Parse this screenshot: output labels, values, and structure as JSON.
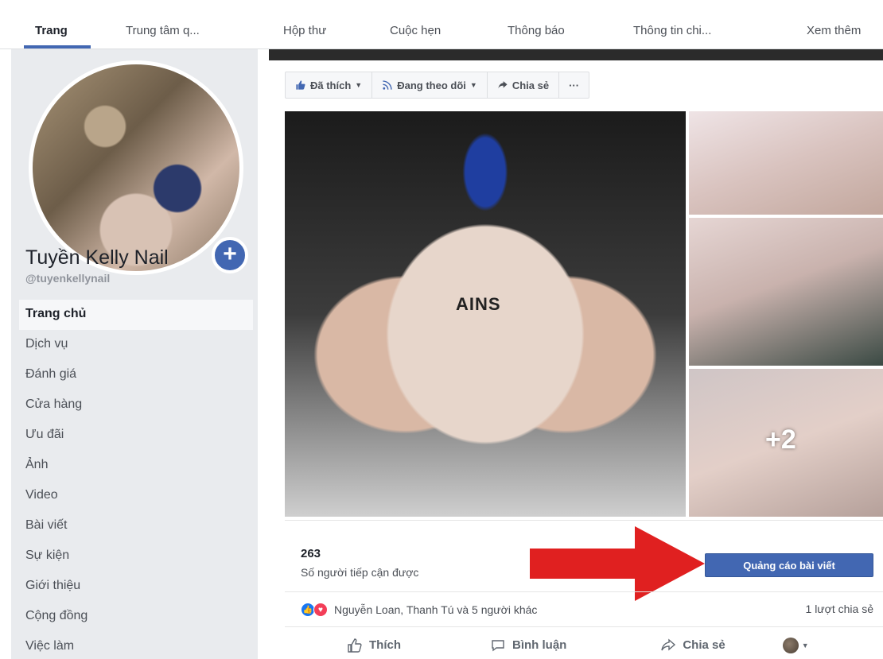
{
  "tabs": [
    {
      "label": "Trang"
    },
    {
      "label": "Trung tâm q..."
    },
    {
      "label": "Hộp thư"
    },
    {
      "label": "Cuộc hẹn"
    },
    {
      "label": "Thông báo"
    },
    {
      "label": "Thông tin chi..."
    },
    {
      "label": "Xem thêm"
    }
  ],
  "page": {
    "name": "Tuyền Kelly Nail",
    "handle": "@tuyenkellynail",
    "add_photo_glyph": "+"
  },
  "sidebar": {
    "items": [
      {
        "label": "Trang chủ"
      },
      {
        "label": "Dịch vụ"
      },
      {
        "label": "Đánh giá"
      },
      {
        "label": "Cửa hàng"
      },
      {
        "label": "Ưu đãi"
      },
      {
        "label": "Ảnh"
      },
      {
        "label": "Video"
      },
      {
        "label": "Bài viết"
      },
      {
        "label": "Sự kiện"
      },
      {
        "label": "Giới thiệu"
      },
      {
        "label": "Cộng đồng"
      },
      {
        "label": "Việc làm"
      }
    ]
  },
  "actions": {
    "liked_label": "Đã thích",
    "following_label": "Đang theo dõi",
    "share_label": "Chia sẻ",
    "more_label": "···"
  },
  "photos": {
    "jar_text": "AINS",
    "more_count": "+2"
  },
  "post": {
    "reach_count": "263",
    "reach_label": "Số người tiếp cận được",
    "promote_label": "Quảng cáo bài viết",
    "reactions_text": "Nguyễn Loan, Thanh Tú và 5 người khác",
    "shares_text": "1 lượt chia sẻ",
    "like_label": "Thích",
    "comment_label": "Bình luận",
    "share_label": "Chia sẻ"
  },
  "colors": {
    "brand_blue": "#4267b2",
    "arrow_red": "#e02020",
    "sidebar_bg": "#e9ebee"
  },
  "icons": {
    "like": "thumbs-up-icon",
    "follow": "rss-icon",
    "share": "share-arrow-icon",
    "comment": "speech-bubble-icon"
  }
}
